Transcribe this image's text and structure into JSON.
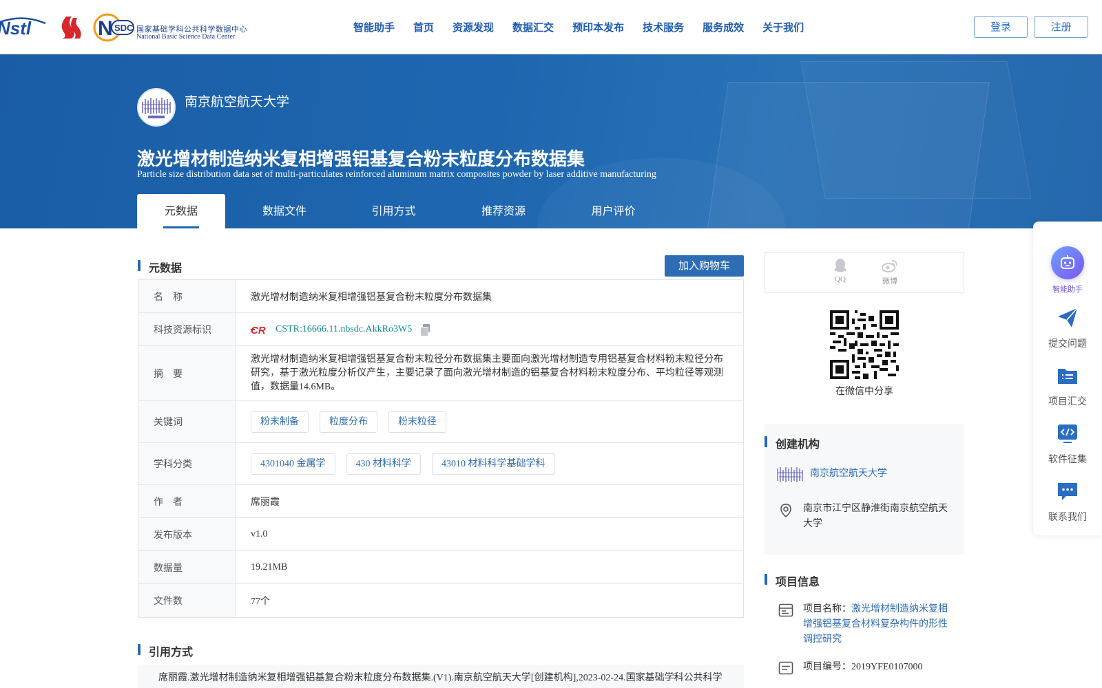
{
  "header": {
    "nav": [
      "智能助手",
      "首页",
      "资源发现",
      "数据汇交",
      "预印本发布",
      "技术服务",
      "服务成效",
      "关于我们"
    ],
    "login_label": "登录",
    "register_label": "注册",
    "nstl_logo_text": "Nstl",
    "nsdc_logo_badge": "SDC",
    "nsdc_logo_cn": "国家基础学科公共科学数据中心",
    "nsdc_logo_en": "National Basic Science Data Center"
  },
  "banner": {
    "org_name": "南京航空航天大学",
    "title_cn": "激光增材制造纳米复相增强铝基复合粉末粒度分布数据集",
    "title_en": "Particle size distribution data set of multi-particulates reinforced aluminum matrix composites powder by laser additive manufacturing",
    "tabs": [
      "元数据",
      "数据文件",
      "引用方式",
      "推荐资源",
      "用户评价"
    ],
    "active_tab": "元数据"
  },
  "metadata": {
    "section_title": "元数据",
    "cart_label": "加入购物车",
    "rows": [
      {
        "key": "名　称",
        "value": "激光增材制造纳米复相增强铝基复合粉末粒度分布数据集"
      },
      {
        "key": "科技资源标识",
        "value": "CSTR:16666.11.nbsdc.AkkRo3W5",
        "badge": "CSTR"
      },
      {
        "key": "摘　要",
        "value": "激光增材制造纳米复相增强铝基复合粉末粒径分布数据集主要面向激光增材制造专用铝基复合材料粉末粒径分布研究，基于激光粒度分析仪产生，主要记录了面向激光增材制造的铝基复合材料粉末粒度分布、平均粒径等观测值，数据量14.6MB。"
      },
      {
        "key": "关键词",
        "tags": [
          "粉末制备",
          "粒度分布",
          "粉末粒径"
        ]
      },
      {
        "key": "学科分类",
        "tags": [
          "4301040 金属学",
          "430 材料科学",
          "43010 材料科学基础学科"
        ]
      },
      {
        "key": "作　者",
        "value": "席丽霞"
      },
      {
        "key": "发布版本",
        "value": "v1.0"
      },
      {
        "key": "数据量",
        "value": "19.21MB"
      },
      {
        "key": "文件数",
        "value": "77个"
      }
    ]
  },
  "citation": {
    "section_title": "引用方式",
    "text": "席丽霞.激光增材制造纳米复相增强铝基复合粉末粒度分布数据集.(V1).南京航空航天大学[创建机构],2023-02-24.国家基础学科公共科学"
  },
  "share": {
    "qq_label": "QQ",
    "weibo_label": "微博",
    "wechat_caption": "在微信中分享"
  },
  "creator": {
    "section_title": "创建机构",
    "org_name": "南京航空航天大学",
    "address": "南京市江宁区静淮街南京航空航天大学"
  },
  "project": {
    "section_title": "项目信息",
    "name_label": "项目名称：",
    "name_value": "激光增材制造纳米复相增强铝基复合材料复杂构件的形性调控研究",
    "code_label": "项目编号：",
    "code_value": "2019YFE0107000"
  },
  "floatbar": {
    "items": [
      "智能助手",
      "提交问题",
      "项目汇交",
      "软件征集",
      "联系我们"
    ]
  },
  "colors": {
    "brand_blue": "#1e67b0",
    "link_blue": "#2e6bb5",
    "cstr_teal": "#0e8a95"
  }
}
